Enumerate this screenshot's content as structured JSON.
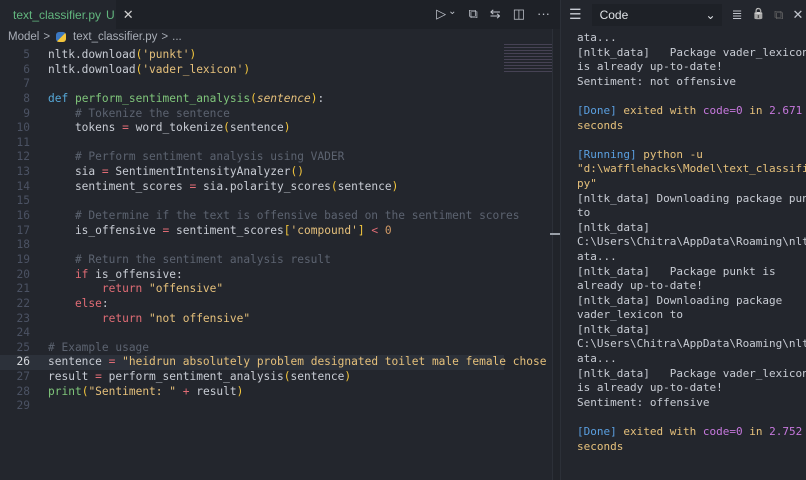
{
  "tab": {
    "filename": "text_classifier.py",
    "status": "U",
    "close": "✕"
  },
  "actions": {
    "run": "▷",
    "run_dropdown": "⌄",
    "open_changes": "⧉",
    "compare": "⇆",
    "split": "◫",
    "more": "···"
  },
  "breadcrumb": {
    "folder": "Model",
    "sep": ">",
    "file": "text_classifier.py",
    "more": "..."
  },
  "code": [
    {
      "n": "5",
      "tokens": [
        [
          "nltk.download",
          "plain"
        ],
        [
          "(",
          "brk"
        ],
        [
          "'punkt'",
          "str"
        ],
        [
          ")",
          "brk"
        ]
      ]
    },
    {
      "n": "6",
      "tokens": [
        [
          "nltk.download",
          "plain"
        ],
        [
          "(",
          "brk"
        ],
        [
          "'vader_lexicon'",
          "str"
        ],
        [
          ")",
          "brk"
        ]
      ]
    },
    {
      "n": "7",
      "tokens": []
    },
    {
      "n": "8",
      "tokens": [
        [
          "def ",
          "kw"
        ],
        [
          "perform_sentiment_analysis",
          "fn"
        ],
        [
          "(",
          "brk"
        ],
        [
          "sentence",
          "par"
        ],
        [
          ")",
          "brk"
        ],
        [
          ":",
          "plain"
        ]
      ]
    },
    {
      "n": "9",
      "tokens": [
        [
          "    # Tokenize the sentence",
          "cm"
        ]
      ]
    },
    {
      "n": "10",
      "tokens": [
        [
          "    tokens ",
          "plain"
        ],
        [
          "=",
          "op"
        ],
        [
          " word_tokenize",
          "plain"
        ],
        [
          "(",
          "brk"
        ],
        [
          "sentence",
          "plain"
        ],
        [
          ")",
          "brk"
        ]
      ]
    },
    {
      "n": "11",
      "tokens": []
    },
    {
      "n": "12",
      "tokens": [
        [
          "    # Perform sentiment analysis using VADER",
          "cm"
        ]
      ]
    },
    {
      "n": "13",
      "tokens": [
        [
          "    sia ",
          "plain"
        ],
        [
          "=",
          "op"
        ],
        [
          " SentimentIntensityAnalyzer",
          "plain"
        ],
        [
          "()",
          "brk"
        ]
      ]
    },
    {
      "n": "14",
      "tokens": [
        [
          "    sentiment_scores ",
          "plain"
        ],
        [
          "=",
          "op"
        ],
        [
          " sia.polarity_scores",
          "plain"
        ],
        [
          "(",
          "brk"
        ],
        [
          "sentence",
          "plain"
        ],
        [
          ")",
          "brk"
        ]
      ]
    },
    {
      "n": "15",
      "tokens": []
    },
    {
      "n": "16",
      "tokens": [
        [
          "    # Determine if the text is offensive based on the sentiment scores",
          "cm"
        ]
      ]
    },
    {
      "n": "17",
      "tokens": [
        [
          "    is_offensive ",
          "plain"
        ],
        [
          "=",
          "op"
        ],
        [
          " sentiment_scores",
          "plain"
        ],
        [
          "[",
          "brk"
        ],
        [
          "'compound'",
          "str"
        ],
        [
          "]",
          "brk"
        ],
        [
          " < ",
          "op"
        ],
        [
          "0",
          "num"
        ]
      ]
    },
    {
      "n": "18",
      "tokens": []
    },
    {
      "n": "19",
      "tokens": [
        [
          "    # Return the sentiment analysis result",
          "cm"
        ]
      ]
    },
    {
      "n": "20",
      "tokens": [
        [
          "    if ",
          "ctl"
        ],
        [
          "is_offensive:",
          "plain"
        ]
      ]
    },
    {
      "n": "21",
      "tokens": [
        [
          "        return ",
          "ctl"
        ],
        [
          "\"offensive\"",
          "str"
        ]
      ]
    },
    {
      "n": "22",
      "tokens": [
        [
          "    else",
          "ctl"
        ],
        [
          ":",
          "plain"
        ]
      ]
    },
    {
      "n": "23",
      "tokens": [
        [
          "        return ",
          "ctl"
        ],
        [
          "\"not offensive\"",
          "str"
        ]
      ]
    },
    {
      "n": "24",
      "tokens": []
    },
    {
      "n": "25",
      "tokens": [
        [
          "# Example usage",
          "cm"
        ]
      ]
    },
    {
      "n": "26",
      "current": true,
      "tokens": [
        [
          "sentence ",
          "plain"
        ],
        [
          "=",
          "op"
        ],
        [
          " \"heidrun absolutely problem designated toilet male female chose to",
          "str"
        ]
      ]
    },
    {
      "n": "27",
      "tokens": [
        [
          "result ",
          "plain"
        ],
        [
          "=",
          "op"
        ],
        [
          " perform_sentiment_analysis",
          "plain"
        ],
        [
          "(",
          "brk"
        ],
        [
          "sentence",
          "plain"
        ],
        [
          ")",
          "brk"
        ]
      ]
    },
    {
      "n": "28",
      "tokens": [
        [
          "print",
          "fn"
        ],
        [
          "(",
          "brk"
        ],
        [
          "\"Sentiment: \"",
          "str"
        ],
        [
          " + ",
          "op"
        ],
        [
          "result",
          "plain"
        ],
        [
          ")",
          "brk"
        ]
      ]
    },
    {
      "n": "29",
      "tokens": []
    }
  ],
  "output_panel": {
    "icon": "☰",
    "channel": "Code",
    "chevron": "⌄",
    "clear": "≣",
    "lock": "🔒",
    "copy": "⧉",
    "close": "✕"
  },
  "output": [
    [
      [
        "ata...",
        "plain"
      ]
    ],
    [
      [
        "[nltk_data]   Package vader_lexicon",
        "plain"
      ]
    ],
    [
      [
        "is already up-to-date!",
        "plain"
      ]
    ],
    [
      [
        "Sentiment: not offensive",
        "plain"
      ]
    ],
    [],
    [
      [
        "[Done]",
        "blue"
      ],
      [
        " exited with ",
        "yel"
      ],
      [
        "code=0",
        "pur"
      ],
      [
        " in ",
        "yel"
      ],
      [
        "2.671",
        "pur"
      ]
    ],
    [
      [
        "seconds",
        "yel"
      ]
    ],
    [],
    [
      [
        "[Running]",
        "blue"
      ],
      [
        " python -u",
        "yel"
      ]
    ],
    [
      [
        "\"d:\\wafflehacks\\Model\\text_classifier.",
        "yel"
      ]
    ],
    [
      [
        "py\"",
        "yel"
      ]
    ],
    [
      [
        "[nltk_data] Downloading package punkt",
        "plain"
      ]
    ],
    [
      [
        "to",
        "plain"
      ]
    ],
    [
      [
        "[nltk_data]",
        "plain"
      ]
    ],
    [
      [
        "C:\\Users\\Chitra\\AppData\\Roaming\\nltk_d",
        "plain"
      ]
    ],
    [
      [
        "ata...",
        "plain"
      ]
    ],
    [
      [
        "[nltk_data]   Package punkt is",
        "plain"
      ]
    ],
    [
      [
        "already up-to-date!",
        "plain"
      ]
    ],
    [
      [
        "[nltk_data] Downloading package",
        "plain"
      ]
    ],
    [
      [
        "vader_lexicon to",
        "plain"
      ]
    ],
    [
      [
        "[nltk_data]",
        "plain"
      ]
    ],
    [
      [
        "C:\\Users\\Chitra\\AppData\\Roaming\\nltk_d",
        "plain"
      ]
    ],
    [
      [
        "ata...",
        "plain"
      ]
    ],
    [
      [
        "[nltk_data]   Package vader_lexicon",
        "plain"
      ]
    ],
    [
      [
        "is already up-to-date!",
        "plain"
      ]
    ],
    [
      [
        "Sentiment: offensive",
        "plain"
      ]
    ],
    [],
    [
      [
        "[Done]",
        "blue"
      ],
      [
        " exited with ",
        "yel"
      ],
      [
        "code=0",
        "pur"
      ],
      [
        " in ",
        "yel"
      ],
      [
        "2.752",
        "pur"
      ]
    ],
    [
      [
        "seconds",
        "yel"
      ]
    ]
  ]
}
